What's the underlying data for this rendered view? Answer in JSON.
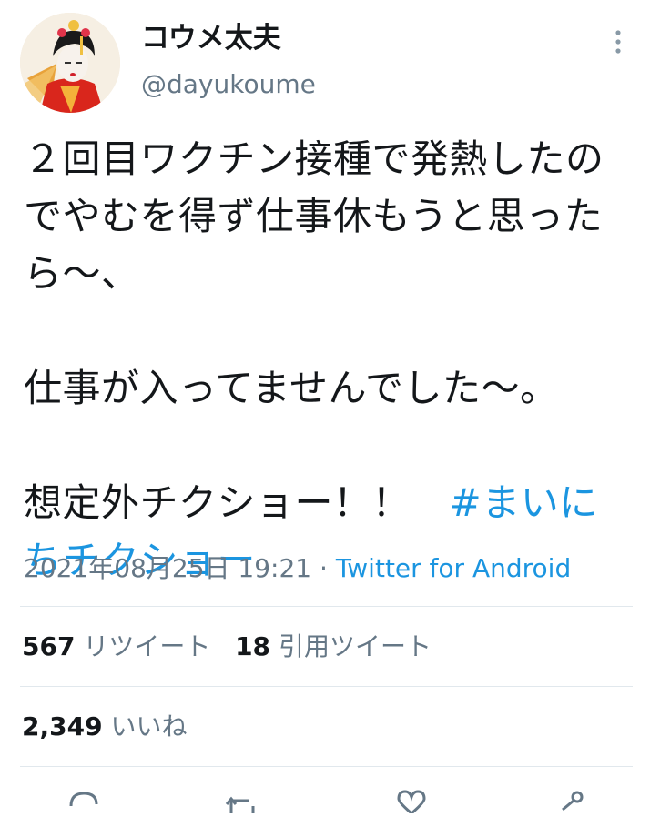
{
  "tweet": {
    "display_name": "コウメ太夫",
    "handle": "@dayukoume",
    "text_line1": "２回目ワクチン接種で発熱したの",
    "text_line2": "でやむを得ず仕事休もうと思った",
    "text_line3": "ら〜、",
    "text_line4": "仕事が入ってませんでした〜。",
    "text_line5_plain": "想定外チクショー！！　",
    "text_line5_hashtag": "#まいに",
    "text_line6_hashtag": "ちチクショー",
    "timestamp": "2021年08月25日 19:21",
    "separator": " · ",
    "source": "Twitter for Android",
    "hashtag_color": "#1b95e0"
  },
  "stats": {
    "retweets_count": "567",
    "retweets_label": "リツイート",
    "quotes_count": "18",
    "quotes_label": "引用ツイート",
    "likes_count": "2,349",
    "likes_label": "いいね"
  },
  "actions": [
    {
      "name": "reply",
      "icon": "comment-icon"
    },
    {
      "name": "retweet",
      "icon": "retweet-icon"
    },
    {
      "name": "like",
      "icon": "heart-icon"
    },
    {
      "name": "share",
      "icon": "share-icon"
    }
  ]
}
